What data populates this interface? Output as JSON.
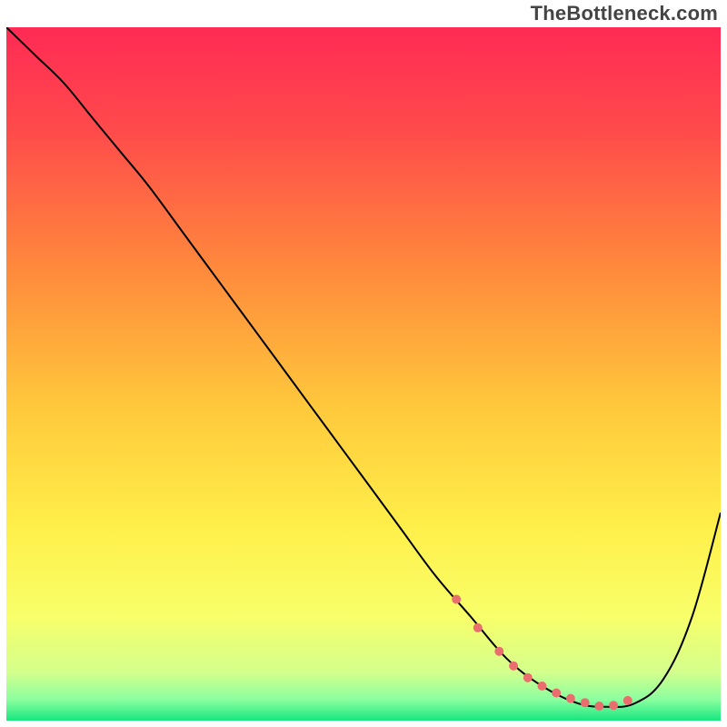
{
  "watermark": "TheBottleneck.com",
  "chart_data": {
    "type": "line",
    "title": "",
    "xlabel": "",
    "ylabel": "",
    "xlim": [
      0,
      100
    ],
    "ylim": [
      0,
      100
    ],
    "grid": false,
    "gradient_stops": [
      {
        "offset": 0.0,
        "color": "#ff2a55"
      },
      {
        "offset": 0.15,
        "color": "#ff4b4b"
      },
      {
        "offset": 0.35,
        "color": "#ff8a3c"
      },
      {
        "offset": 0.55,
        "color": "#ffc93c"
      },
      {
        "offset": 0.72,
        "color": "#ffef4a"
      },
      {
        "offset": 0.85,
        "color": "#f8ff6a"
      },
      {
        "offset": 0.93,
        "color": "#d4ff8c"
      },
      {
        "offset": 0.97,
        "color": "#8affa0"
      },
      {
        "offset": 1.0,
        "color": "#17e67e"
      }
    ],
    "series": [
      {
        "name": "curve",
        "color": "#000000",
        "stroke_width": 2,
        "x": [
          0,
          4,
          8,
          12,
          16,
          20,
          25,
          30,
          35,
          40,
          45,
          50,
          55,
          60,
          65,
          70,
          75,
          80,
          84,
          88,
          92,
          96,
          100
        ],
        "y": [
          100,
          96,
          92,
          87,
          82,
          77,
          70,
          63,
          56,
          49,
          42,
          35,
          28,
          21,
          15,
          9,
          5,
          2.5,
          2,
          2.5,
          6,
          15,
          30
        ]
      },
      {
        "name": "highlight-dots",
        "color": "#eb6e6e",
        "marker_radius": 5,
        "x": [
          63,
          66,
          69,
          71,
          73,
          75,
          77,
          79,
          81,
          83,
          85,
          87
        ],
        "y": [
          17.5,
          13.4,
          10.0,
          7.9,
          6.2,
          5.0,
          4.0,
          3.2,
          2.6,
          2.1,
          2.2,
          2.9
        ]
      }
    ]
  }
}
